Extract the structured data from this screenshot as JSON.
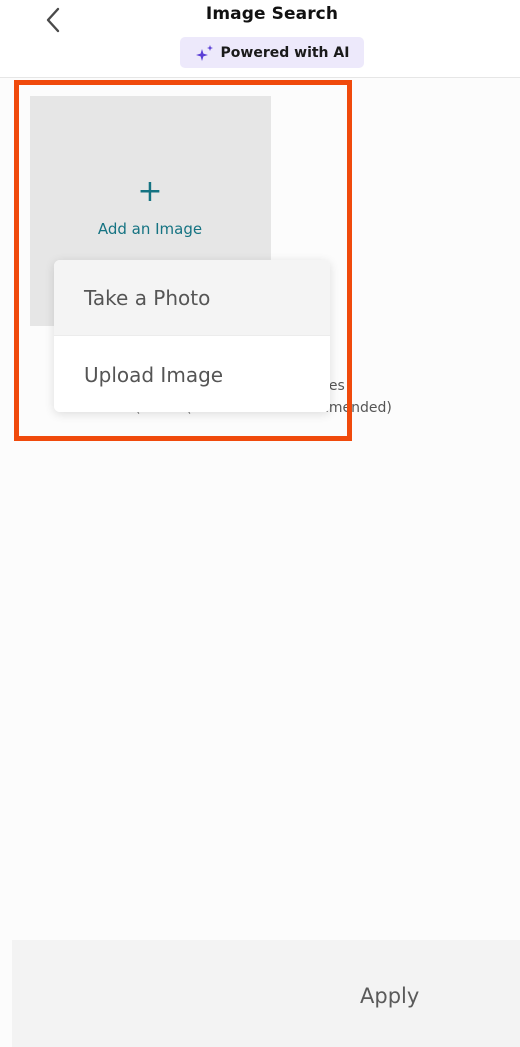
{
  "header": {
    "title": "Image Search",
    "back_icon": "chevron-left-icon",
    "ai_badge": {
      "icon": "sparkles-icon",
      "label": "Powered with AI"
    }
  },
  "upload_tile": {
    "icon": "plus-icon",
    "plus_glyph": "+",
    "label": "Add an Image"
  },
  "hint_fragments": {
    "line1": "ges",
    "line2_a": "(",
    "line2_b": "(",
    "line2_c": "nmended)"
  },
  "menu": {
    "items": [
      {
        "label": "Take a Photo"
      },
      {
        "label": "Upload Image"
      }
    ]
  },
  "footer": {
    "apply_label": "Apply"
  },
  "colors": {
    "accent_teal": "#157382",
    "highlight_orange": "#f04a0c",
    "badge_bg": "#ede9fb",
    "sparkle_purple": "#5b3fd6"
  }
}
